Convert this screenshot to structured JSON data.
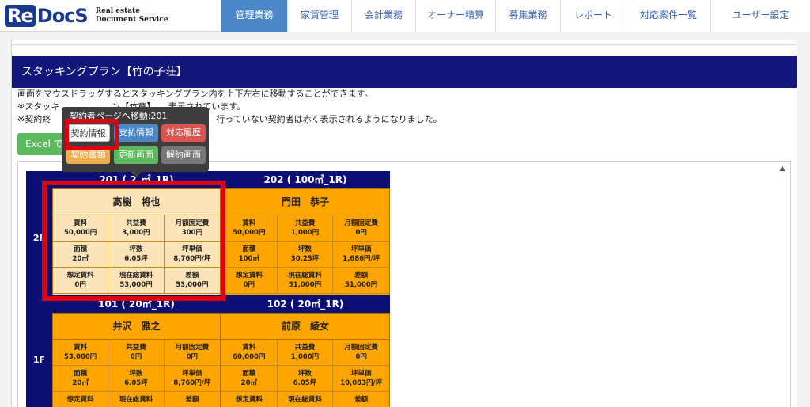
{
  "logo": {
    "mark_re": "Re",
    "mark_docs": "DocS",
    "line1": "Real estate",
    "line2": "Document Service"
  },
  "nav": [
    {
      "label": "管理業務",
      "active": true
    },
    {
      "label": "家賃管理",
      "active": false
    },
    {
      "label": "会計業務",
      "active": false
    },
    {
      "label": "オーナー精算",
      "active": false
    },
    {
      "label": "募集業務",
      "active": false
    },
    {
      "label": "レポート",
      "active": false
    },
    {
      "label": "対応案件一覧",
      "active": false
    },
    {
      "label": "ユーザー設定",
      "active": false
    }
  ],
  "page": {
    "title": "スタッキングプラン【竹の子荘】"
  },
  "description": [
    "画面をマウスドラッグするとスタッキングプラン内を上下左右に移動することができます。",
    "※スタッキ　　　　　　ン【竹章】　　表示されています。",
    "※契約終　　　　　　　　　　　　　　　　　　　行っていない契約者は赤く表示されるようになりました。"
  ],
  "excel_button": "Excel で",
  "popup": {
    "title": "契約者ページへ移動:201",
    "buttons": [
      "契約情報",
      "支払情報",
      "対応履歴",
      "契約書類",
      "更新画面",
      "解約画面"
    ]
  },
  "colors": {
    "navy": "#12157a",
    "plan_bg": "#0d0e73",
    "unit_vacant": "#ffa500",
    "unit_selected": "#fde4b8",
    "highlight": "#e00010",
    "nav_active": "#4a86c8"
  },
  "floors": [
    {
      "label": "2F",
      "units": [
        {
          "header": "201 ( 2_㎡_1R)",
          "name": "高樹　将也",
          "selected": true,
          "cells": [
            {
              "label": "賃料",
              "value": "50,000円"
            },
            {
              "label": "共益費",
              "value": "3,000円"
            },
            {
              "label": "月額固定費",
              "value": "300円"
            },
            {
              "label": "面積",
              "value": "20㎡"
            },
            {
              "label": "坪数",
              "value": "6.05坪"
            },
            {
              "label": "坪単価",
              "value": "8,760円/坪"
            },
            {
              "label": "想定賃料",
              "value": "0円"
            },
            {
              "label": "現在総賃料",
              "value": "53,000円"
            },
            {
              "label": "差額",
              "value": "53,000円"
            }
          ]
        },
        {
          "header": "202 ( 100㎡_1R)",
          "name": "門田　恭子",
          "selected": false,
          "cells": [
            {
              "label": "賃料",
              "value": "50,000円"
            },
            {
              "label": "共益費",
              "value": "1,000円"
            },
            {
              "label": "月額固定費",
              "value": "0円"
            },
            {
              "label": "面積",
              "value": "100㎡"
            },
            {
              "label": "坪数",
              "value": "30.25坪"
            },
            {
              "label": "坪単価",
              "value": "1,686円/坪"
            },
            {
              "label": "想定賃料",
              "value": "0円"
            },
            {
              "label": "現在総賃料",
              "value": "51,000円"
            },
            {
              "label": "差額",
              "value": "51,000円"
            }
          ]
        }
      ]
    },
    {
      "label": "1F",
      "units": [
        {
          "header": "101 ( 20㎡_1R)",
          "name": "井沢　雅之",
          "selected": false,
          "cells": [
            {
              "label": "賃料",
              "value": "53,000円"
            },
            {
              "label": "共益費",
              "value": "0円"
            },
            {
              "label": "月額固定費",
              "value": "0円"
            },
            {
              "label": "面積",
              "value": "20㎡"
            },
            {
              "label": "坪数",
              "value": "6.05坪"
            },
            {
              "label": "坪単価",
              "value": "8,760円/坪"
            },
            {
              "label": "想定賃料",
              "value": ""
            },
            {
              "label": "現在総賃料",
              "value": ""
            },
            {
              "label": "差額",
              "value": ""
            }
          ]
        },
        {
          "header": "102 ( 20㎡_1R)",
          "name": "前原　綾女",
          "selected": false,
          "cells": [
            {
              "label": "賃料",
              "value": "60,000円"
            },
            {
              "label": "共益費",
              "value": "1,000円"
            },
            {
              "label": "月額固定費",
              "value": "0円"
            },
            {
              "label": "面積",
              "value": "20㎡"
            },
            {
              "label": "坪数",
              "value": "6.05坪"
            },
            {
              "label": "坪単価",
              "value": "10,083円/坪"
            },
            {
              "label": "想定賃料",
              "value": ""
            },
            {
              "label": "現在総賃料",
              "value": ""
            },
            {
              "label": "差額",
              "value": ""
            }
          ]
        }
      ]
    }
  ]
}
